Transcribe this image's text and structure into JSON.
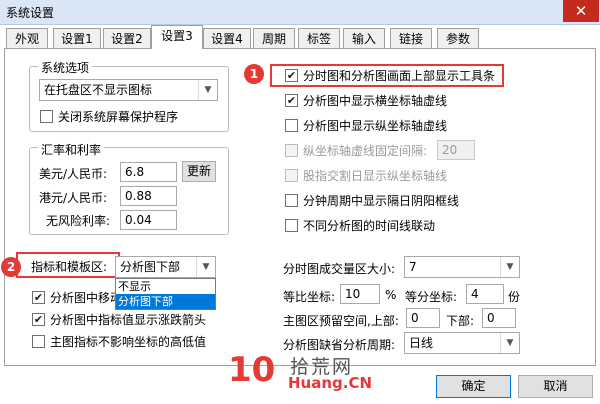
{
  "window": {
    "title": "系统设置",
    "close_glyph": "✕"
  },
  "tabs": [
    "外观",
    "设置1",
    "设置2",
    "设置3",
    "设置4",
    "周期",
    "标签",
    "输入",
    "链接",
    "参数"
  ],
  "system_options": {
    "title": "系统选项",
    "tray_select": "在托盘区不显示图标",
    "close_screensaver_label": "关闭系统屏幕保护程序"
  },
  "exchange": {
    "title": "汇率和利率",
    "usd_label": "美元/人民币:",
    "usd_value": "6.8",
    "hkd_label": "港元/人民币:",
    "hkd_value": "0.88",
    "riskfree_label": "无风险利率:",
    "riskfree_value": "0.04",
    "update_button": "更新"
  },
  "right_options": [
    {
      "label": "分时图和分析图画面上部显示工具条",
      "checked": true,
      "disabled": false
    },
    {
      "label": "分析图中显示横坐标轴虚线",
      "checked": true,
      "disabled": false
    },
    {
      "label": "分析图中显示纵坐标轴虚线",
      "checked": false,
      "disabled": false
    },
    {
      "label": "纵坐标轴虚线固定间隔:",
      "checked": false,
      "disabled": true
    },
    {
      "label": "股指交割日显示纵坐标轴线",
      "checked": false,
      "disabled": true
    },
    {
      "label": "分钟周期中显示隔日阴阳框线",
      "checked": false,
      "disabled": false
    },
    {
      "label": "不同分析图的时间线联动",
      "checked": false,
      "disabled": false
    }
  ],
  "interval_value": "20",
  "indicator": {
    "label": "指标和模板区:",
    "select_value": "分析图下部",
    "options": [
      "不显示",
      "分析图下部"
    ]
  },
  "lower_left_options": [
    {
      "label": "分析图中移动",
      "checked": true
    },
    {
      "label": "分析图中指标值显示涨跌箭头",
      "checked": true
    },
    {
      "label": "主图指标不影响坐标的高低值",
      "checked": false
    }
  ],
  "lower_right": {
    "vol_area_label": "分时图成交量区大小:",
    "vol_area_value": "7",
    "ratio_label": "等比坐标:",
    "ratio_value": "10",
    "ratio_unit": "%",
    "equal_label": "等分坐标:",
    "equal_value": "4",
    "equal_unit": "份",
    "reserve_label": "主图区预留空间,上部:",
    "reserve_top": "0",
    "reserve_bottom_label": "下部:",
    "reserve_bottom": "0",
    "default_period_label": "分析图缺省分析周期:",
    "default_period_value": "日线"
  },
  "badges": {
    "one": "1",
    "two": "2"
  },
  "watermark": {
    "num": "10",
    "cn": "拾荒网",
    "en": "Huang.CN"
  },
  "buttons": {
    "ok": "确定",
    "cancel": "取消"
  },
  "colors": {
    "accent": "#0078d7",
    "annotation": "#e53935",
    "close": "#c42b1c"
  }
}
